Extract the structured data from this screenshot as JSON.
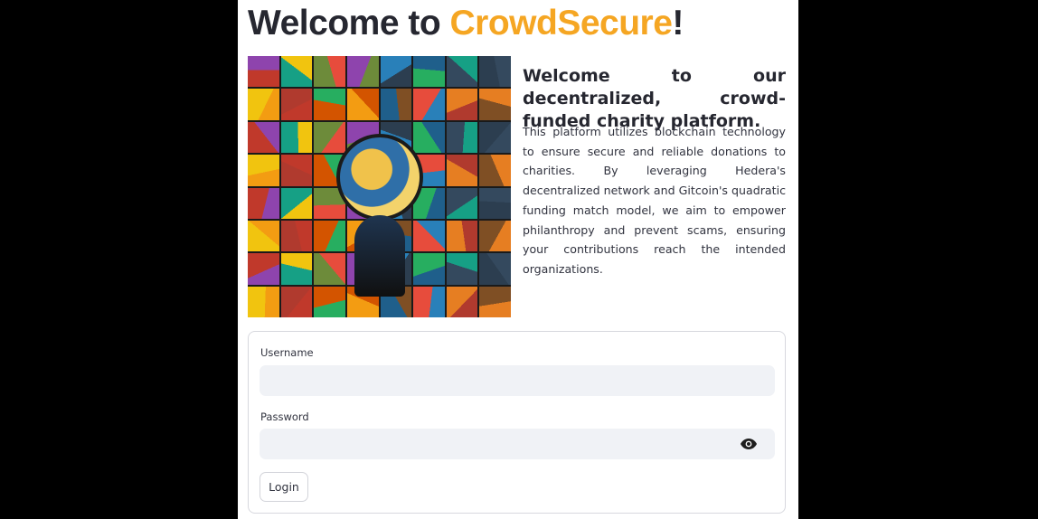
{
  "header": {
    "title_prefix": "Welcome to ",
    "title_brand": "CrowdSecure",
    "title_suffix": "!"
  },
  "intro": {
    "heading": "Welcome to our decentralized, crowd-funded charity platform.",
    "body": "This platform utilizes blockchain technology to ensure secure and reliable donations to charities. By leveraging Hedera's decentralized network and Gitcoin's quadratic funding match model, we aim to empower philanthropy and prevent scams, ensuring your contributions reach the intended organizations."
  },
  "collage": {
    "icon": "charity-collage-image",
    "tile_colors": [
      "#c0392b",
      "#2c3e50",
      "#e67e22",
      "#27ae60",
      "#1f5f8b",
      "#8e44ad",
      "#d35400",
      "#16a085",
      "#f1c40f",
      "#7f4f24",
      "#34495e",
      "#e74c3c",
      "#2980b9",
      "#f39c12",
      "#6d8b3a",
      "#b03a2e"
    ]
  },
  "form": {
    "username_label": "Username",
    "username_value": "",
    "password_label": "Password",
    "password_value": "",
    "show_password_icon": "eye-icon",
    "login_label": "Login"
  },
  "colors": {
    "brand": "#f5a623",
    "input_bg": "#f0f2f6",
    "text": "#262730"
  }
}
